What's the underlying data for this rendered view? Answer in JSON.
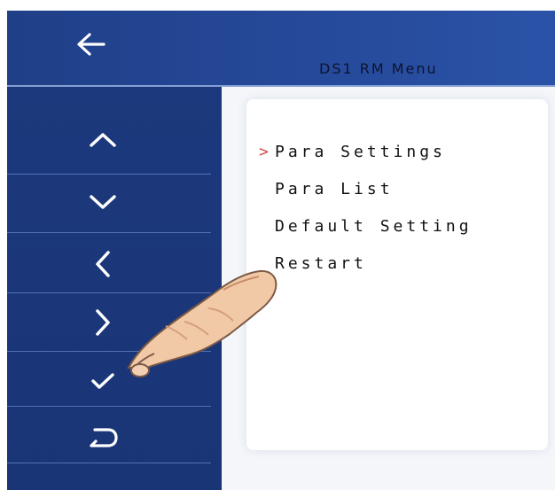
{
  "header": {
    "title": "DS1 RM Menu",
    "back_icon": "arrow-left-icon"
  },
  "sidebar": {
    "buttons": [
      {
        "name": "up-button",
        "icon": "chevron-up-icon"
      },
      {
        "name": "down-button",
        "icon": "chevron-down-icon"
      },
      {
        "name": "left-button",
        "icon": "chevron-left-icon"
      },
      {
        "name": "right-button",
        "icon": "chevron-right-icon"
      },
      {
        "name": "confirm-button",
        "icon": "checkmark-icon"
      },
      {
        "name": "return-button",
        "icon": "return-icon"
      }
    ]
  },
  "menu": {
    "selected_marker": ">",
    "items": [
      {
        "label": "Para Settings",
        "selected": true
      },
      {
        "label": "Para List",
        "selected": false
      },
      {
        "label": "Default Setting",
        "selected": false
      },
      {
        "label": "Restart",
        "selected": false
      }
    ]
  },
  "colors": {
    "topbar": "#26499a",
    "sidebar": "#1c397d",
    "divider": "#5f7fc0",
    "content_background": "#f4f6fa",
    "panel_background": "#ffffff",
    "selection_marker": "#d34a4a",
    "menu_text": "#111111",
    "title_text": "#0d1430"
  }
}
